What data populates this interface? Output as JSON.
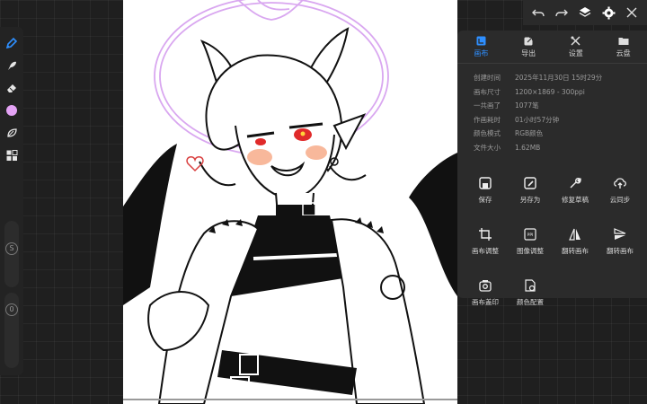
{
  "toolbar_left": {
    "tools": [
      "pen-tool",
      "smudge-tool",
      "eraser-tool",
      "color",
      "layers-shape-tool",
      "grid-tool"
    ],
    "active_color": "#e4a3f5",
    "size_label": "S",
    "opacity_label": "0"
  },
  "top_bar": {
    "buttons": [
      "undo",
      "redo",
      "layers",
      "settings",
      "close"
    ]
  },
  "panel": {
    "tabs": [
      {
        "label": "画布",
        "icon": "canvas-icon"
      },
      {
        "label": "导出",
        "icon": "export-icon"
      },
      {
        "label": "设置",
        "icon": "settings-icon"
      },
      {
        "label": "云盘",
        "icon": "cloud-folder-icon"
      }
    ],
    "active_tab": 0,
    "info": [
      {
        "key": "创建时间",
        "value": "2025年11月30日 15时29分"
      },
      {
        "key": "画布尺寸",
        "value": "1200×1869 - 300ppi"
      },
      {
        "key": "一共画了",
        "value": "1077笔"
      },
      {
        "key": "作画耗时",
        "value": "01小时57分钟"
      },
      {
        "key": "颜色模式",
        "value": "RGB颜色"
      },
      {
        "key": "文件大小",
        "value": "1.62MB"
      }
    ],
    "actions": [
      {
        "label": "保存",
        "icon": "save-icon"
      },
      {
        "label": "另存为",
        "icon": "save-as-icon"
      },
      {
        "label": "修复草稿",
        "icon": "repair-icon"
      },
      {
        "label": "云同步",
        "icon": "cloud-sync-icon"
      },
      {
        "label": "画布调整",
        "icon": "crop-icon"
      },
      {
        "label": "图像调整",
        "icon": "image-adjust-icon"
      },
      {
        "label": "翻转画布",
        "icon": "flip-horizontal-icon"
      },
      {
        "label": "翻转画布",
        "icon": "flip-vertical-icon"
      },
      {
        "label": "画布盖印",
        "icon": "stamp-icon"
      },
      {
        "label": "颜色配置",
        "icon": "color-config-icon"
      }
    ]
  },
  "colors": {
    "accent": "#2e8fff",
    "halo": "#d9a7f0",
    "eyes": "#e02a2a",
    "blush": "#f6a07a",
    "heart": "#d94040"
  }
}
